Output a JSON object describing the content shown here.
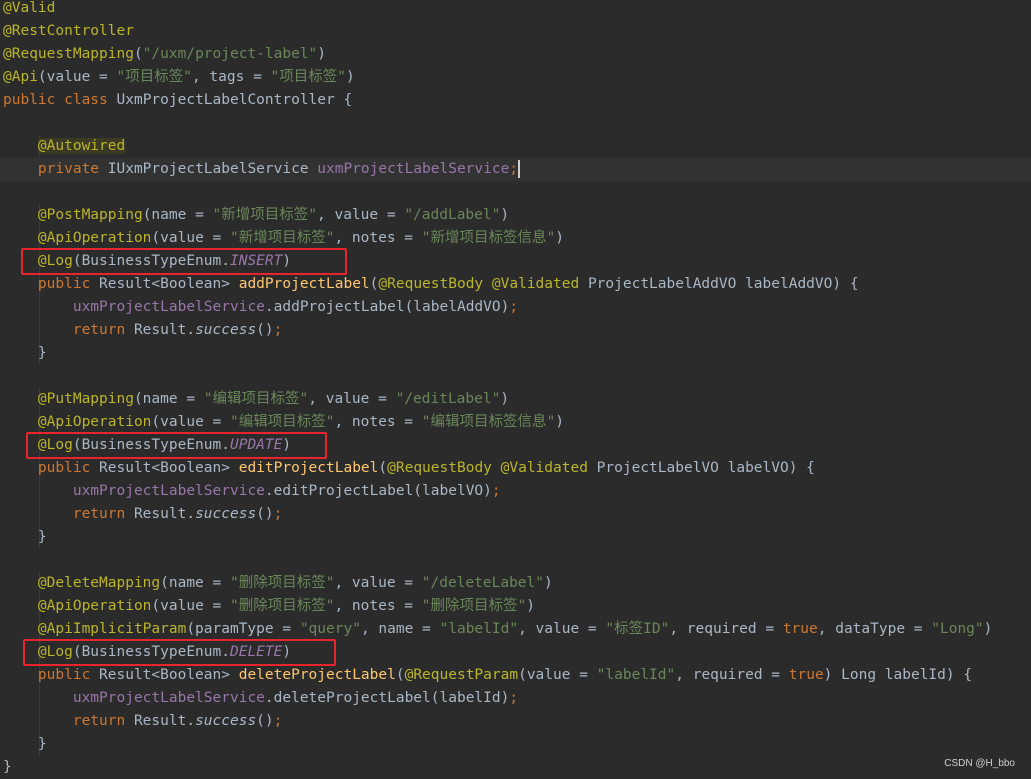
{
  "editor": {
    "lines": [
      [
        {
          "t": "@Valid",
          "c": "ann"
        }
      ],
      [
        {
          "t": "@RestController",
          "c": "ann"
        }
      ],
      [
        {
          "t": "@RequestMapping",
          "c": "ann"
        },
        {
          "t": "(",
          "c": "cls"
        },
        {
          "t": "\"/uxm/project-label\"",
          "c": "str"
        },
        {
          "t": ")",
          "c": "cls"
        }
      ],
      [
        {
          "t": "@Api",
          "c": "ann"
        },
        {
          "t": "(value = ",
          "c": "cls"
        },
        {
          "t": "\"项目标签\"",
          "c": "str"
        },
        {
          "t": ", tags = ",
          "c": "cls"
        },
        {
          "t": "\"项目标签\"",
          "c": "str"
        },
        {
          "t": ")",
          "c": "cls"
        }
      ],
      [
        {
          "t": "public class ",
          "c": "kw"
        },
        {
          "t": "UxmProjectLabelController {",
          "c": "cls"
        }
      ],
      [],
      [
        {
          "t": "    ",
          "c": "cls"
        },
        {
          "t": "@Autowired",
          "c": "ann autowired"
        }
      ],
      [
        {
          "t": "    ",
          "c": "cls"
        },
        {
          "t": "private ",
          "c": "kw"
        },
        {
          "t": "IUxmProjectLabelService ",
          "c": "cls"
        },
        {
          "t": "uxmProjectLabelService",
          "c": "fld"
        },
        {
          "t": ";",
          "c": "kw"
        },
        {
          "t": "",
          "c": "cursor"
        }
      ],
      [],
      [
        {
          "t": "    ",
          "c": "cls"
        },
        {
          "t": "@PostMapping",
          "c": "ann"
        },
        {
          "t": "(name = ",
          "c": "cls"
        },
        {
          "t": "\"新增项目标签\"",
          "c": "str"
        },
        {
          "t": ", value = ",
          "c": "cls"
        },
        {
          "t": "\"/addLabel\"",
          "c": "str"
        },
        {
          "t": ")",
          "c": "cls"
        }
      ],
      [
        {
          "t": "    ",
          "c": "cls"
        },
        {
          "t": "@ApiOperation",
          "c": "ann"
        },
        {
          "t": "(value = ",
          "c": "cls"
        },
        {
          "t": "\"新增项目标签\"",
          "c": "str"
        },
        {
          "t": ", notes = ",
          "c": "cls"
        },
        {
          "t": "\"新增项目标签信息\"",
          "c": "str"
        },
        {
          "t": ")",
          "c": "cls"
        }
      ],
      [
        {
          "t": "    ",
          "c": "cls"
        },
        {
          "t": "@Log",
          "c": "ann"
        },
        {
          "t": "(BusinessTypeEnum.",
          "c": "cls"
        },
        {
          "t": "INSERT",
          "c": "fld it"
        },
        {
          "t": ")",
          "c": "cls"
        }
      ],
      [
        {
          "t": "    ",
          "c": "cls"
        },
        {
          "t": "public ",
          "c": "kw"
        },
        {
          "t": "Result<Boolean> ",
          "c": "cls"
        },
        {
          "t": "addProjectLabel",
          "c": "fn"
        },
        {
          "t": "(",
          "c": "cls"
        },
        {
          "t": "@RequestBody ",
          "c": "ann"
        },
        {
          "t": "@Validated ",
          "c": "ann"
        },
        {
          "t": "ProjectLabelAddVO labelAddVO) {",
          "c": "cls"
        }
      ],
      [
        {
          "t": "        ",
          "c": "cls"
        },
        {
          "t": "uxmProjectLabelService",
          "c": "fld"
        },
        {
          "t": ".addProjectLabel(labelAddVO)",
          "c": "cls"
        },
        {
          "t": ";",
          "c": "kw"
        }
      ],
      [
        {
          "t": "        ",
          "c": "cls"
        },
        {
          "t": "return ",
          "c": "kw"
        },
        {
          "t": "Result.",
          "c": "cls"
        },
        {
          "t": "success",
          "c": "it"
        },
        {
          "t": "()",
          "c": "cls"
        },
        {
          "t": ";",
          "c": "kw"
        }
      ],
      [
        {
          "t": "    }",
          "c": "cls"
        }
      ],
      [],
      [
        {
          "t": "    ",
          "c": "cls"
        },
        {
          "t": "@PutMapping",
          "c": "ann"
        },
        {
          "t": "(name = ",
          "c": "cls"
        },
        {
          "t": "\"编辑项目标签\"",
          "c": "str"
        },
        {
          "t": ", value = ",
          "c": "cls"
        },
        {
          "t": "\"/editLabel\"",
          "c": "str"
        },
        {
          "t": ")",
          "c": "cls"
        }
      ],
      [
        {
          "t": "    ",
          "c": "cls"
        },
        {
          "t": "@ApiOperation",
          "c": "ann"
        },
        {
          "t": "(value = ",
          "c": "cls"
        },
        {
          "t": "\"编辑项目标签\"",
          "c": "str"
        },
        {
          "t": ", notes = ",
          "c": "cls"
        },
        {
          "t": "\"编辑项目标签信息\"",
          "c": "str"
        },
        {
          "t": ")",
          "c": "cls"
        }
      ],
      [
        {
          "t": "    ",
          "c": "cls"
        },
        {
          "t": "@Log",
          "c": "ann"
        },
        {
          "t": "(BusinessTypeEnum.",
          "c": "cls"
        },
        {
          "t": "UPDATE",
          "c": "fld it"
        },
        {
          "t": ")",
          "c": "cls"
        }
      ],
      [
        {
          "t": "    ",
          "c": "cls"
        },
        {
          "t": "public ",
          "c": "kw"
        },
        {
          "t": "Result<Boolean> ",
          "c": "cls"
        },
        {
          "t": "editProjectLabel",
          "c": "fn"
        },
        {
          "t": "(",
          "c": "cls"
        },
        {
          "t": "@RequestBody ",
          "c": "ann"
        },
        {
          "t": "@Validated ",
          "c": "ann"
        },
        {
          "t": "ProjectLabelVO labelVO) {",
          "c": "cls"
        }
      ],
      [
        {
          "t": "        ",
          "c": "cls"
        },
        {
          "t": "uxmProjectLabelService",
          "c": "fld"
        },
        {
          "t": ".editProjectLabel(labelVO)",
          "c": "cls"
        },
        {
          "t": ";",
          "c": "kw"
        }
      ],
      [
        {
          "t": "        ",
          "c": "cls"
        },
        {
          "t": "return ",
          "c": "kw"
        },
        {
          "t": "Result.",
          "c": "cls"
        },
        {
          "t": "success",
          "c": "it"
        },
        {
          "t": "()",
          "c": "cls"
        },
        {
          "t": ";",
          "c": "kw"
        }
      ],
      [
        {
          "t": "    }",
          "c": "cls"
        }
      ],
      [],
      [
        {
          "t": "    ",
          "c": "cls"
        },
        {
          "t": "@DeleteMapping",
          "c": "ann"
        },
        {
          "t": "(name = ",
          "c": "cls"
        },
        {
          "t": "\"删除项目标签\"",
          "c": "str"
        },
        {
          "t": ", value = ",
          "c": "cls"
        },
        {
          "t": "\"/deleteLabel\"",
          "c": "str"
        },
        {
          "t": ")",
          "c": "cls"
        }
      ],
      [
        {
          "t": "    ",
          "c": "cls"
        },
        {
          "t": "@ApiOperation",
          "c": "ann"
        },
        {
          "t": "(value = ",
          "c": "cls"
        },
        {
          "t": "\"删除项目标签\"",
          "c": "str"
        },
        {
          "t": ", notes = ",
          "c": "cls"
        },
        {
          "t": "\"删除项目标签\"",
          "c": "str"
        },
        {
          "t": ")",
          "c": "cls"
        }
      ],
      [
        {
          "t": "    ",
          "c": "cls"
        },
        {
          "t": "@ApiImplicitParam",
          "c": "ann"
        },
        {
          "t": "(paramType = ",
          "c": "cls"
        },
        {
          "t": "\"query\"",
          "c": "str"
        },
        {
          "t": ", name = ",
          "c": "cls"
        },
        {
          "t": "\"labelId\"",
          "c": "str"
        },
        {
          "t": ", value = ",
          "c": "cls"
        },
        {
          "t": "\"标签ID\"",
          "c": "str"
        },
        {
          "t": ", required = ",
          "c": "cls"
        },
        {
          "t": "true",
          "c": "kw"
        },
        {
          "t": ", dataType = ",
          "c": "cls"
        },
        {
          "t": "\"Long\"",
          "c": "str"
        },
        {
          "t": ")",
          "c": "cls"
        }
      ],
      [
        {
          "t": "    ",
          "c": "cls"
        },
        {
          "t": "@Log",
          "c": "ann"
        },
        {
          "t": "(BusinessTypeEnum.",
          "c": "cls"
        },
        {
          "t": "DELETE",
          "c": "fld it"
        },
        {
          "t": ")",
          "c": "cls"
        }
      ],
      [
        {
          "t": "    ",
          "c": "cls"
        },
        {
          "t": "public ",
          "c": "kw"
        },
        {
          "t": "Result<Boolean> ",
          "c": "cls"
        },
        {
          "t": "deleteProjectLabel",
          "c": "fn"
        },
        {
          "t": "(",
          "c": "cls"
        },
        {
          "t": "@RequestParam",
          "c": "ann"
        },
        {
          "t": "(value = ",
          "c": "cls"
        },
        {
          "t": "\"labelId\"",
          "c": "str"
        },
        {
          "t": ", required = ",
          "c": "cls"
        },
        {
          "t": "true",
          "c": "kw"
        },
        {
          "t": ") Long labelId) {",
          "c": "cls"
        }
      ],
      [
        {
          "t": "        ",
          "c": "cls"
        },
        {
          "t": "uxmProjectLabelService",
          "c": "fld"
        },
        {
          "t": ".deleteProjectLabel(labelId)",
          "c": "cls"
        },
        {
          "t": ";",
          "c": "kw"
        }
      ],
      [
        {
          "t": "        ",
          "c": "cls"
        },
        {
          "t": "return ",
          "c": "kw"
        },
        {
          "t": "Result.",
          "c": "cls"
        },
        {
          "t": "success",
          "c": "it"
        },
        {
          "t": "()",
          "c": "cls"
        },
        {
          "t": ";",
          "c": "kw"
        }
      ],
      [
        {
          "t": "    }",
          "c": "cls"
        }
      ],
      [
        {
          "t": "}",
          "c": "cls"
        }
      ]
    ],
    "current_line": 7,
    "highlighted_lines": [
      11,
      19,
      28
    ]
  },
  "watermark": "CSDN @H_bbo",
  "colors": {
    "background": "#2b2b2b",
    "annotation": "#bbb529",
    "keyword": "#cc7832",
    "string": "#6a8759",
    "field": "#9876aa",
    "method": "#ffc66d",
    "text": "#a9b7c6",
    "highlight_box": "#e8252c"
  }
}
